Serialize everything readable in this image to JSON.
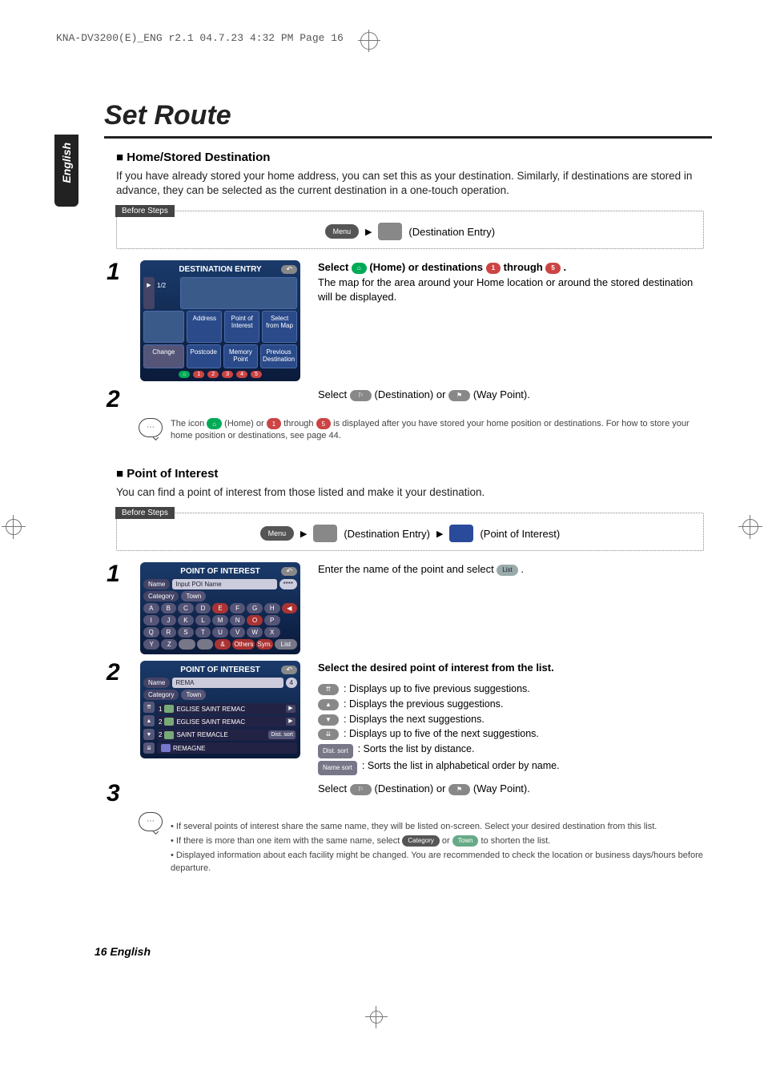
{
  "crop_header": "KNA-DV3200(E)_ENG r2.1  04.7.23  4:32 PM  Page 16",
  "language_tab": "English",
  "title": "Set Route",
  "footer": "16 English",
  "home_section": {
    "heading": "Home/Stored Destination",
    "intro": "If you have already stored your home address, you can set this as your destination. Similarly, if destinations are stored in advance, they can be selected as the current destination in a one-touch operation.",
    "before_label": "Before Steps",
    "before_menu": "Menu",
    "before_text": "(Destination Entry)",
    "step1": {
      "ss_title": "DESTINATION ENTRY",
      "ss_pager": "1/2",
      "ss_cells": [
        "Address",
        "Point of Interest",
        "Select from Map",
        "Postcode",
        "Memory Point",
        "Previous Destination"
      ],
      "ss_change": "Change",
      "line_a": "Select ",
      "chip_home": "⌂",
      "line_b": " (Home) or destinations ",
      "chip_1": "1",
      "line_c": " through ",
      "chip_5": "5",
      "line_d": ".",
      "line2": "The map for the area around your Home location or around the stored destination will be displayed."
    },
    "step2": {
      "line_a": "Select ",
      "chip_dest": "⚐",
      "line_b": " (Destination) or ",
      "chip_wp": "⚑",
      "line_c": " (Way Point)."
    },
    "note": {
      "a": "The icon ",
      "b": " (Home) or ",
      "c": " through ",
      "d": " is displayed after you have stored your home position or destinations. For how to store your home position or destinations, see page 44."
    }
  },
  "poi_section": {
    "heading": "Point of Interest",
    "intro": "You can find a point of interest from those listed and make it your destination.",
    "before_label": "Before Steps",
    "before_menu": "Menu",
    "before_mid": "(Destination Entry)",
    "before_end": "(Point of Interest)",
    "step1": {
      "ss_title": "POINT OF INTEREST",
      "ss_name_lbl": "Name",
      "ss_name_val": "Input POI Name",
      "ss_cat_lbl": "Category",
      "ss_town_lbl": "Town",
      "ss_count": "****",
      "kb_rows": [
        [
          "A",
          "B",
          "C",
          "D",
          "E",
          "F",
          "G",
          "H",
          "◀"
        ],
        [
          "I",
          "J",
          "K",
          "L",
          "M",
          "N",
          "O",
          "P",
          ""
        ],
        [
          "Q",
          "R",
          "S",
          "T",
          "U",
          "V",
          "W",
          "X",
          ""
        ],
        [
          "Y",
          "Z",
          "",
          "",
          "&",
          "Others",
          "Sym.",
          "",
          "List"
        ]
      ],
      "text_a": "Enter the name of the point and select ",
      "chip_list": "List",
      "text_b": "."
    },
    "step2": {
      "ss_title": "POINT OF INTEREST",
      "ss_name_lbl": "Name",
      "ss_name_val": "REMA",
      "ss_count": "4",
      "ss_cat_lbl": "Category",
      "ss_town_lbl": "Town",
      "ss_list": [
        "EGLISE SAINT REMAC",
        "EGLISE SAINT REMAC",
        "SAINT REMACLE",
        "REMAGNE"
      ],
      "ss_list_nums": [
        "1",
        "2",
        "2",
        ""
      ],
      "ss_sort1": "Dist. sort",
      "heading": "Select the desired point of interest from the list.",
      "items": [
        {
          "chip": "⇈",
          "text": ": Displays up to five previous suggestions."
        },
        {
          "chip": "▲",
          "text": ": Displays the previous suggestions."
        },
        {
          "chip": "▼",
          "text": ": Displays the next suggestions."
        },
        {
          "chip": "⇊",
          "text": ": Displays up to five of the next suggestions."
        },
        {
          "chip_box": "Dist. sort",
          "text": ": Sorts the list by distance."
        },
        {
          "chip_box": "Name sort",
          "text": ": Sorts the list in alphabetical order by name."
        }
      ]
    },
    "step3": {
      "line_a": "Select ",
      "chip_dest": "⚐",
      "line_b": " (Destination) or ",
      "chip_wp": "⚑",
      "line_c": " (Way Point)."
    },
    "tips": [
      "If several points of interest share the same name, they will be listed on-screen.  Select your desired destination from this list.",
      "If there is more than one item with the same name, select    Category    or   Town   to shorten the list.",
      "Displayed information about each facility might be changed. You are recommended to check the location or business days/hours before departure."
    ],
    "tip2_parts": {
      "a": "If there is more than one item with the same name, select ",
      "cat": "Category",
      "b": " or ",
      "town": "Town",
      "c": " to shorten the list."
    }
  }
}
